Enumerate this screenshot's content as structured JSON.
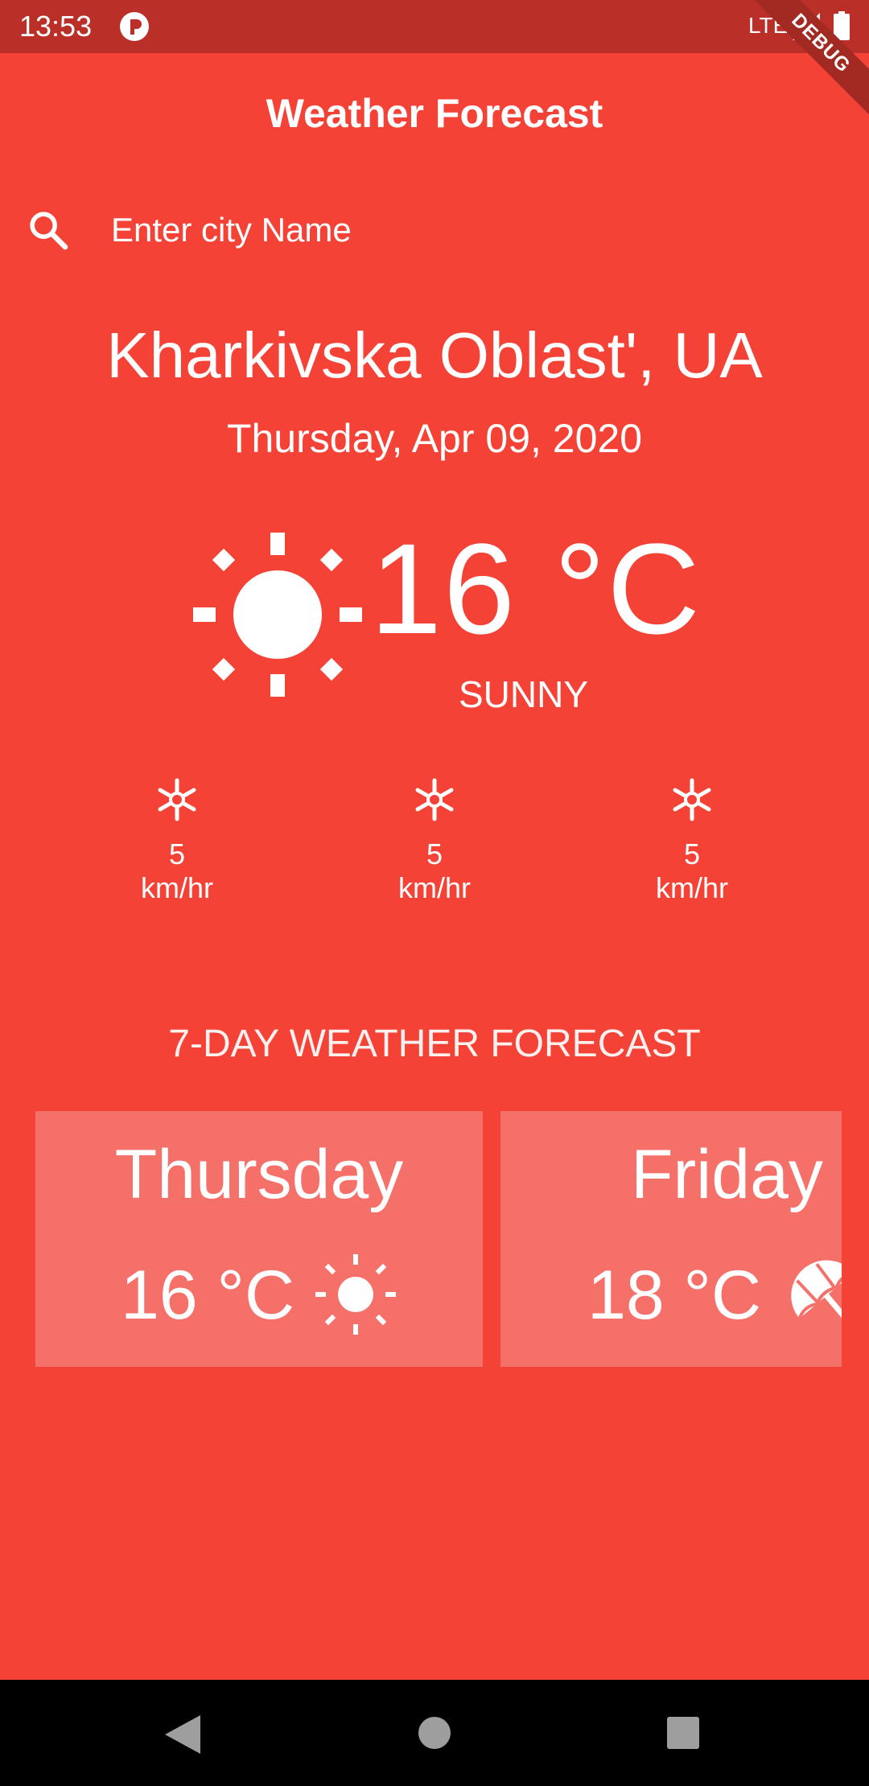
{
  "status_bar": {
    "time": "13:53",
    "network": "LTE",
    "debug_label": "DEBUG"
  },
  "app_bar": {
    "title": "Weather Forecast"
  },
  "search": {
    "placeholder": "Enter city Name",
    "value": ""
  },
  "current": {
    "city": "Kharkivska Oblast', UA",
    "date": "Thursday, Apr 09, 2020",
    "temperature": "16 °C",
    "condition": "SUNNY",
    "condition_icon": "sun-icon"
  },
  "wind": [
    {
      "value": "5",
      "unit": "km/hr",
      "icon": "snowflake-icon"
    },
    {
      "value": "5",
      "unit": "km/hr",
      "icon": "snowflake-icon"
    },
    {
      "value": "5",
      "unit": "km/hr",
      "icon": "snowflake-icon"
    }
  ],
  "forecast": {
    "heading": "7-DAY WEATHER FORECAST",
    "days": [
      {
        "day": "Thursday",
        "temp": "16 °C",
        "icon": "sun-icon"
      },
      {
        "day": "Friday",
        "temp": "18 °C",
        "icon": "umbrella-icon"
      }
    ]
  },
  "colors": {
    "background": "#F44336",
    "status_bar": "#BA2F28",
    "card": "#F6706A",
    "nav_bar": "#000000"
  }
}
